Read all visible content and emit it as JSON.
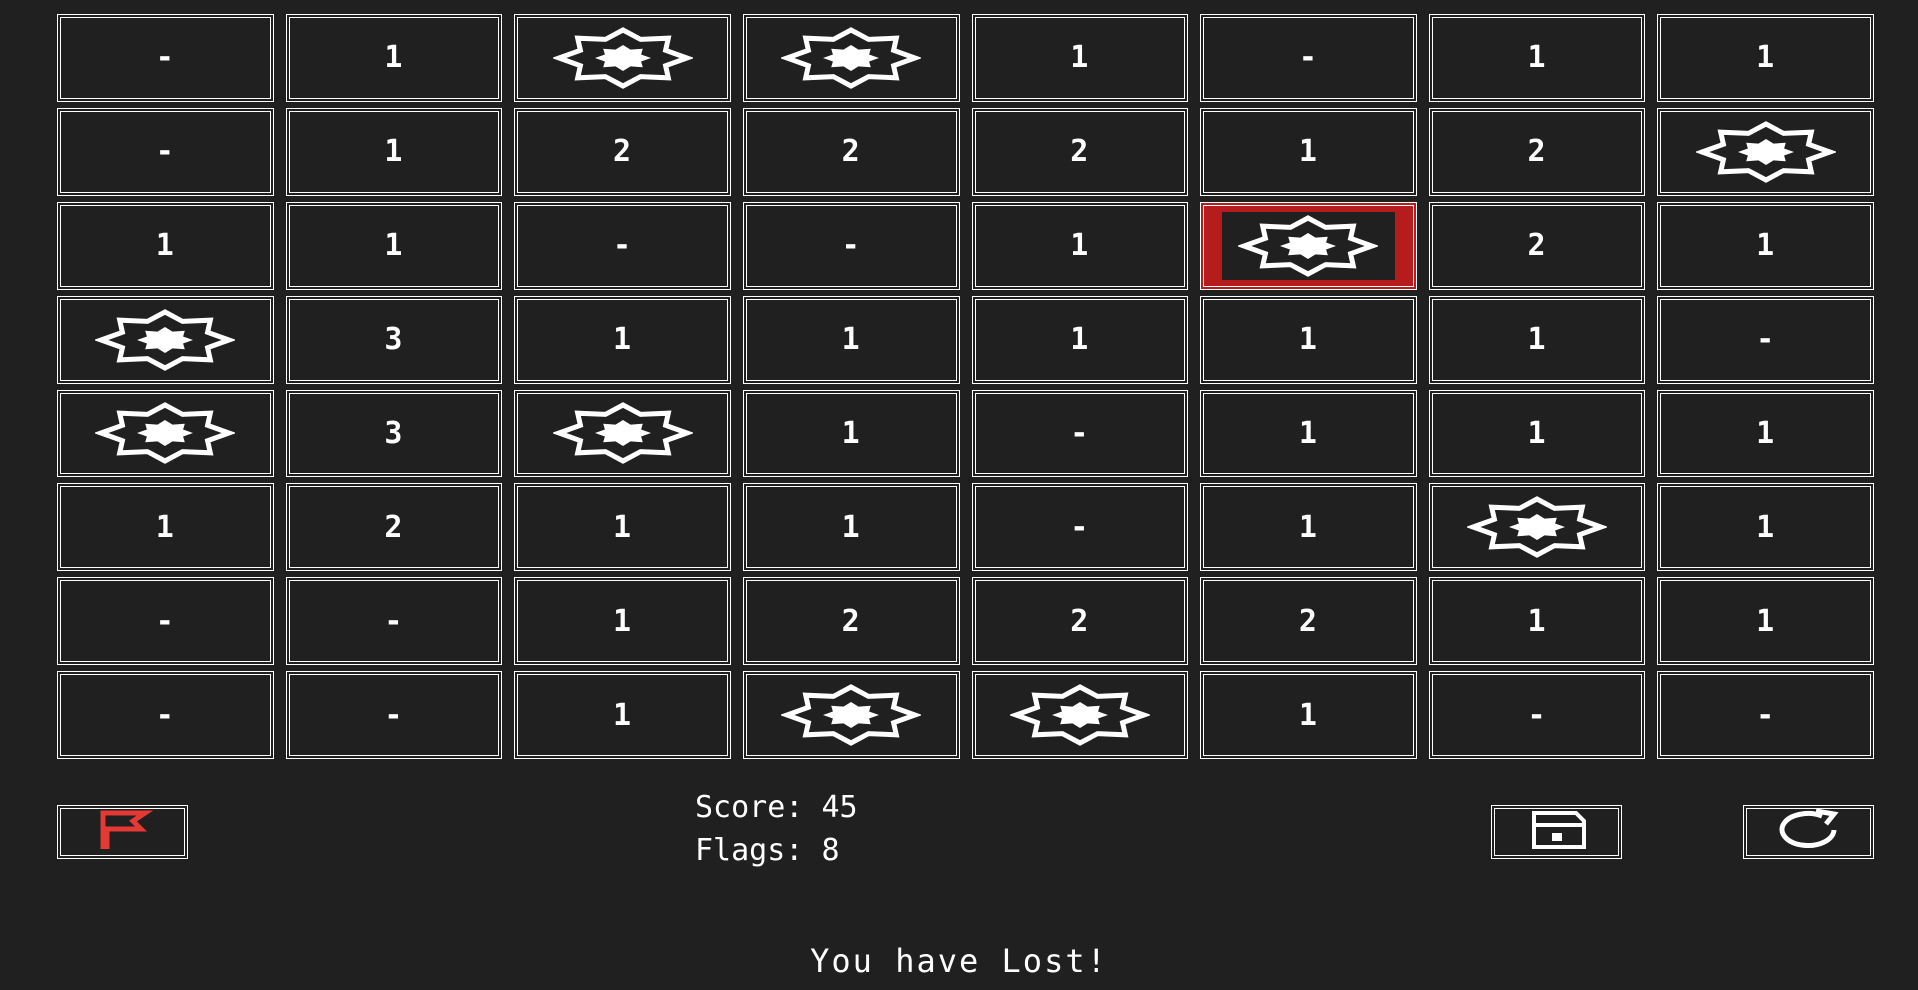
{
  "board": {
    "rows": [
      [
        "-",
        "1",
        "mine",
        "mine",
        "1",
        "-",
        "1",
        "1"
      ],
      [
        "-",
        "1",
        "2",
        "2",
        "2",
        "1",
        "2",
        "mine"
      ],
      [
        "1",
        "1",
        "-",
        "-",
        "1",
        "mine-exploded",
        "2",
        "1"
      ],
      [
        "mine",
        "3",
        "1",
        "1",
        "1",
        "1",
        "1",
        "-"
      ],
      [
        "mine",
        "3",
        "mine",
        "1",
        "-",
        "1",
        "1",
        "1"
      ],
      [
        "1",
        "2",
        "1",
        "1",
        "-",
        "1",
        "mine",
        "1"
      ],
      [
        "-",
        "-",
        "1",
        "2",
        "2",
        "2",
        "1",
        "1"
      ],
      [
        "-",
        "-",
        "1",
        "mine",
        "mine",
        "1",
        "-",
        "-"
      ]
    ],
    "mine_icon": "mine-icon",
    "exploded_color": "#b71c1c"
  },
  "toolbar": {
    "flag_icon": "flag-icon",
    "flag_color": "#e53935",
    "save_icon": "floppy-disk-icon",
    "reset_icon": "refresh-icon"
  },
  "status": {
    "score_label": "Score:",
    "score_value": "45",
    "flags_label": "Flags:",
    "flags_value": "8",
    "message": "You have Lost!"
  },
  "colors": {
    "background": "#202020",
    "foreground": "#ffffff"
  }
}
